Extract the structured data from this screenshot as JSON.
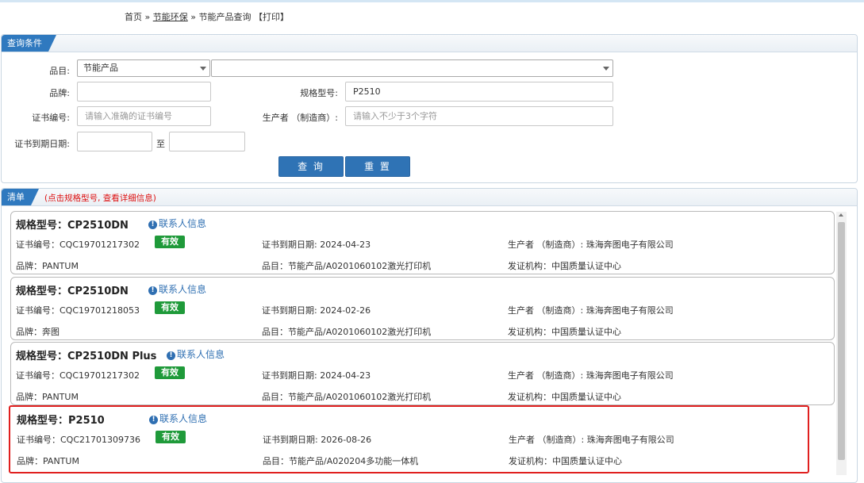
{
  "breadcrumb": {
    "home": "首页",
    "sep1": "»",
    "section": "节能环保",
    "sep2": "»",
    "current": "节能产品查询 【打印】"
  },
  "query": {
    "tab": "查询条件",
    "category_label": "品目:",
    "category_value": "节能产品",
    "subcategory_value": "",
    "brand_label": "品牌:",
    "brand_value": "",
    "model_label": "规格型号:",
    "model_value": "P2510",
    "cert_label": "证书编号:",
    "cert_placeholder": "请输入准确的证书编号",
    "maker_label": "生产者 （制造商）:",
    "maker_placeholder": "请输入不少于3个字符",
    "expire_label": "证书到期日期:",
    "to_label": "至",
    "search_button": "查 询",
    "reset_button": "重 置"
  },
  "list": {
    "tab": "清单",
    "hint": "(点击规格型号, 查看详细信息)",
    "contact_label": "联系人信息",
    "status_badge": "有效",
    "badge_color": "#1f9a3a",
    "items": [
      {
        "model": "规格型号：CP2510DN",
        "cert": "证书编号：CQC19701217302",
        "expire": "证书到期日期: 2024-04-23",
        "maker": "生产者 （制造商）: 珠海奔图电子有限公司",
        "brand": "品牌：PANTUM",
        "category": "品目：节能产品/A0201060102激光打印机",
        "issuer": "发证机构：中国质量认证中心"
      },
      {
        "model": "规格型号：CP2510DN",
        "cert": "证书编号：CQC19701218053",
        "expire": "证书到期日期: 2024-02-26",
        "maker": "生产者 （制造商）: 珠海奔图电子有限公司",
        "brand": "品牌：奔图",
        "category": "品目：节能产品/A0201060102激光打印机",
        "issuer": "发证机构：中国质量认证中心"
      },
      {
        "model": "规格型号：CP2510DN Plus",
        "cert": "证书编号：CQC19701217302",
        "expire": "证书到期日期: 2024-04-23",
        "maker": "生产者 （制造商）: 珠海奔图电子有限公司",
        "brand": "品牌：PANTUM",
        "category": "品目：节能产品/A0201060102激光打印机",
        "issuer": "发证机构：中国质量认证中心"
      },
      {
        "model": "规格型号：P2510",
        "cert": "证书编号：CQC21701309736",
        "expire": "证书到期日期: 2026-08-26",
        "maker": "生产者 （制造商）: 珠海奔图电子有限公司",
        "brand": "品牌：PANTUM",
        "category": "品目：节能产品/A020204多功能一体机",
        "issuer": "发证机构：中国质量认证中心"
      }
    ]
  }
}
